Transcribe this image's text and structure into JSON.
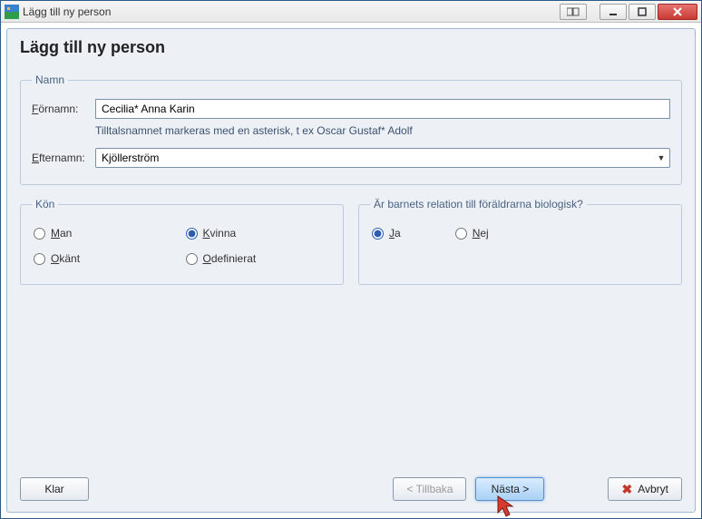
{
  "window": {
    "title": "Lägg till ny person"
  },
  "page": {
    "heading": "Lägg till ny person"
  },
  "name_group": {
    "legend": "Namn",
    "fornamn_label": "Förnamn:",
    "fornamn_value": "Cecilia* Anna Karin",
    "hint": "Tilltalsnamnet markeras med en asterisk, t ex  Oscar Gustaf* Adolf",
    "efternamn_label": "Efternamn:",
    "efternamn_value": "Kjöllerström"
  },
  "gender_group": {
    "legend": "Kön",
    "options": {
      "man": "Man",
      "kvinna": "Kvinna",
      "okant": "Okänt",
      "odefinierat": "Odefinierat"
    },
    "selected": "kvinna"
  },
  "relation_group": {
    "legend": "Är barnets relation till föräldrarna biologisk?",
    "options": {
      "ja": "Ja",
      "nej": "Nej"
    },
    "selected": "ja"
  },
  "buttons": {
    "klar": "Klar",
    "tillbaka": "< Tillbaka",
    "nasta": "Nästa >",
    "avbryt": "Avbryt"
  }
}
